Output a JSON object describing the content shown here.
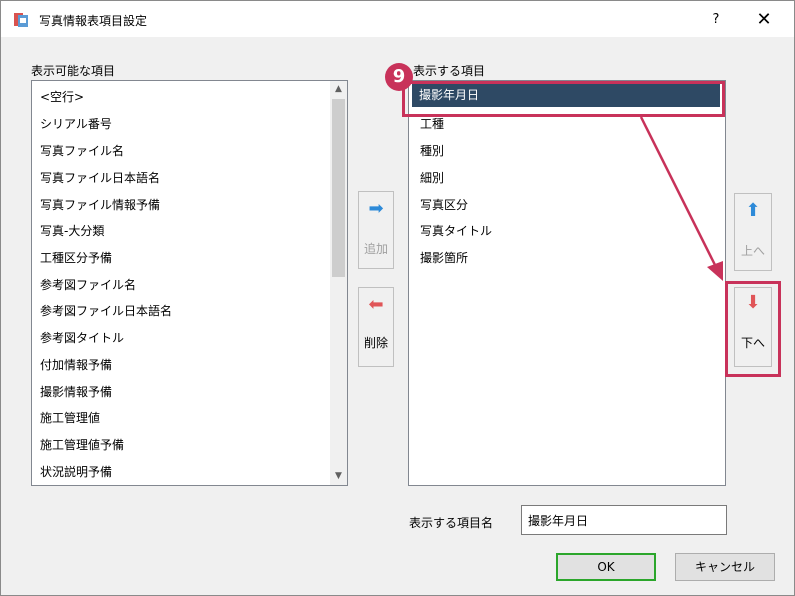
{
  "window": {
    "title": "写真情報表項目設定",
    "help": "?",
    "close": "✕"
  },
  "available": {
    "label": "表示可能な項目",
    "items": [
      "<空行>",
      "シリアル番号",
      "写真ファイル名",
      "写真ファイル日本語名",
      "写真ファイル情報予備",
      "写真-大分類",
      "工種区分予備",
      "参考図ファイル名",
      "参考図ファイル日本語名",
      "参考図タイトル",
      "付加情報予備",
      "撮影情報予備",
      "施工管理値",
      "施工管理値予備",
      "状況説明予備"
    ]
  },
  "display": {
    "label": "表示する項目",
    "selected": "撮影年月日",
    "items": [
      "工種",
      "種別",
      "細別",
      "写真区分",
      "写真タイトル",
      "撮影箇所"
    ]
  },
  "buttons": {
    "add_label": "追加",
    "remove_label": "削除",
    "up_label": "上へ",
    "down_label": "下へ",
    "ok_label": "OK",
    "cancel_label": "キャンセル"
  },
  "name_field": {
    "label": "表示する項目名",
    "value": "撮影年月日"
  },
  "annotation": {
    "step": "9",
    "color": "#c8325a"
  },
  "icons": {
    "add": "arrow-right-icon",
    "remove": "arrow-left-icon",
    "up": "arrow-up-icon",
    "down": "arrow-down-icon"
  }
}
